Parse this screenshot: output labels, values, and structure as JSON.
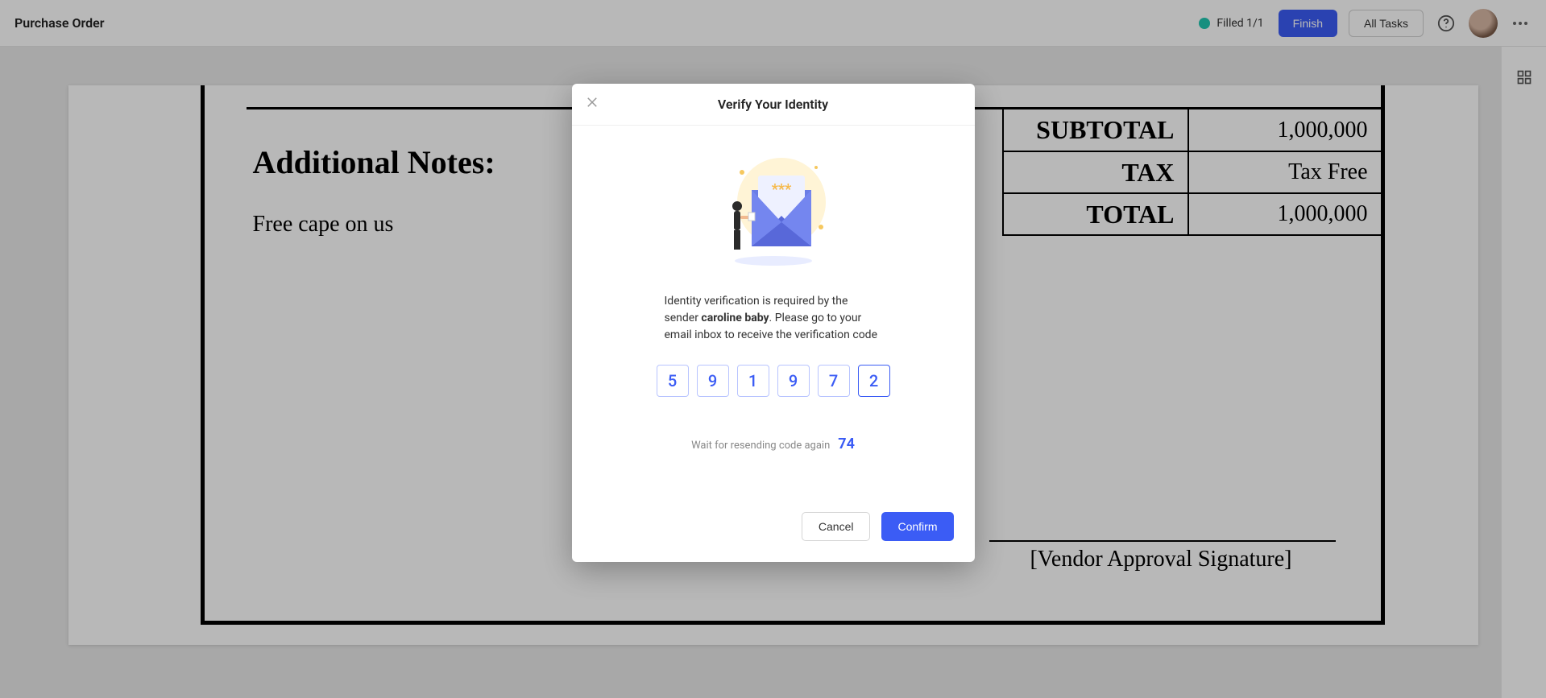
{
  "header": {
    "title": "Purchase Order",
    "status": "Filled 1/1",
    "finish": "Finish",
    "all_tasks": "All Tasks"
  },
  "document": {
    "notes_title": "Additional Notes:",
    "notes_text": "Free cape on us",
    "totals": {
      "subtotal_label": "SUBTOTAL",
      "subtotal_value": "1,000,000",
      "tax_label": "TAX",
      "tax_value": "Tax Free",
      "total_label": "TOTAL",
      "total_value": "1,000,000"
    },
    "signature_label": "[Vendor Approval Signature]"
  },
  "modal": {
    "title": "Verify Your Identity",
    "text_pre": "Identity verification is required by the sender ",
    "sender": "caroline baby",
    "text_post": ". Please go to your email inbox to receive the verification code",
    "code": [
      "5",
      "9",
      "1",
      "9",
      "7",
      "2"
    ],
    "resend_label": "Wait for resending code again",
    "resend_count": "74",
    "cancel": "Cancel",
    "confirm": "Confirm"
  }
}
